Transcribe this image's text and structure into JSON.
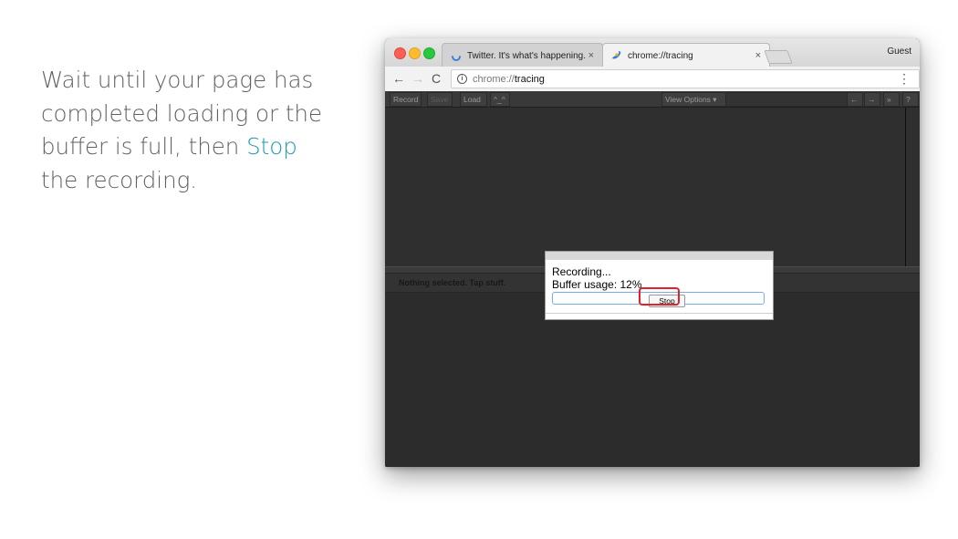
{
  "instruction": {
    "line1": "Wait until your page has",
    "line2": "completed loading or the",
    "line3_prefix": "buffer is full, then ",
    "line3_highlight": "Stop",
    "line4": "the recording.",
    "highlight_color": "#1a9bb0"
  },
  "browser": {
    "tabs": [
      {
        "title": "Twitter. It's what's happening.",
        "close": "×",
        "icon": "loading-spinner-icon",
        "active": false
      },
      {
        "title": "chrome://tracing",
        "close": "×",
        "icon": "chrome-tracing-icon",
        "active": true
      }
    ],
    "profile": "Guest",
    "nav": {
      "back": "←",
      "forward": "→",
      "reload": "C"
    },
    "url_scheme": "chrome://",
    "url_host": "tracing",
    "menu": "⋮"
  },
  "tracing": {
    "toolbar": {
      "record": "Record",
      "save": "Save",
      "load": "Load",
      "mode": "^_^",
      "view_options": "View Options ▾",
      "prev": "←",
      "next": "→",
      "close": "»",
      "help": "?"
    },
    "analysis_text": "Nothing selected. Tap stuff."
  },
  "dialog": {
    "status": "Recording...",
    "buffer": "Buffer usage: 12%",
    "stop_label": "Stop",
    "highlight_color": "#e5202a"
  }
}
